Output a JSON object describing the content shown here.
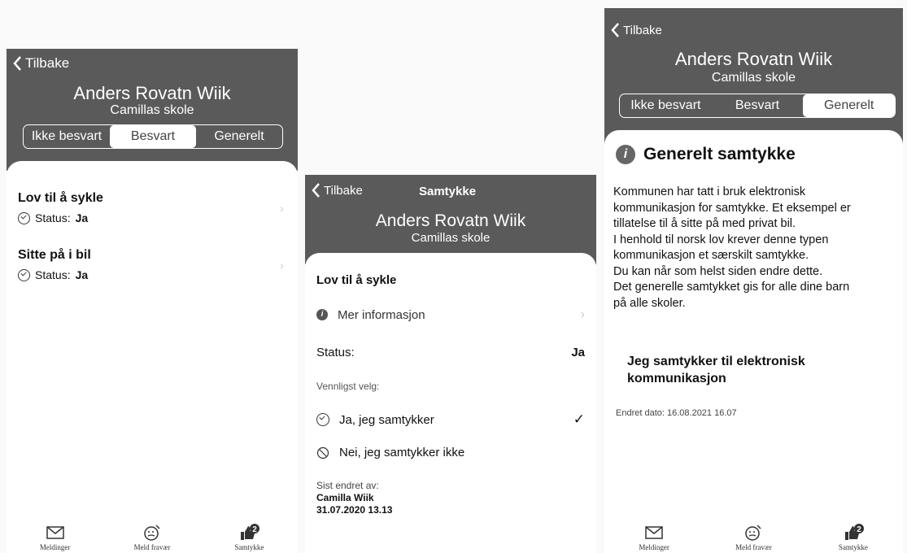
{
  "colors": {
    "header": "#5a5a5a",
    "sheet": "#ffffff",
    "text": "#111111"
  },
  "screen1": {
    "back": "Tilbake",
    "name": "Anders Rovatn Wiik",
    "school": "Camillas skole",
    "tabs": [
      "Ikke besvart",
      "Besvart",
      "Generelt"
    ],
    "selected_tab": "Besvart",
    "items": [
      {
        "title": "Lov til å sykle",
        "status_label": "Status:",
        "status_value": "Ja"
      },
      {
        "title": "Sitte på i bil",
        "status_label": "Status:",
        "status_value": "Ja"
      }
    ],
    "tabbar": [
      {
        "label": "Meldinger",
        "icon": "mail-icon"
      },
      {
        "label": "Meld fravær",
        "icon": "edit-face-icon"
      },
      {
        "label": "Samtykke",
        "icon": "thumbs-up-icon",
        "badge": "2"
      }
    ]
  },
  "screen2": {
    "back": "Tilbake",
    "title": "Samtykke",
    "name": "Anders Rovatn Wiik",
    "school": "Camillas skole",
    "item_title": "Lov til å sykle",
    "more_info": "Mer informasjon",
    "status_label": "Status:",
    "status_value": "Ja",
    "choose_label": "Vennligst velg:",
    "option_yes": "Ja, jeg samtykker",
    "option_no": "Nei, jeg samtykker ikke",
    "changed_by_label": "Sist endret av:",
    "changed_by_name": "Camilla Wiik",
    "changed_date": "31.07.2020 13.13"
  },
  "screen3": {
    "back": "Tilbake",
    "name": "Anders Rovatn Wiik",
    "school": "Camillas skole",
    "tabs": [
      "Ikke besvart",
      "Besvart",
      "Generelt"
    ],
    "selected_tab": "Generelt",
    "heading": "Generelt samtykke",
    "body_lines": [
      "Kommunen har tatt i bruk elektronisk",
      "kommunikasjon for samtykke. Et eksempel er",
      "tillatelse til å sitte på med privat bil.",
      "I henhold til norsk lov krever denne typen",
      "kommunikasjon et særskilt samtykke.",
      "Du kan når som helst siden endre dette.",
      "Det generelle samtykket gis for alle dine barn",
      "på alle skoler."
    ],
    "consent_line1": "Jeg samtykker til elektronisk",
    "consent_line2": "kommunikasjon",
    "changed_date": "Endret dato: 16.08.2021 16.07",
    "tabbar": [
      {
        "label": "Meldinger",
        "icon": "mail-icon"
      },
      {
        "label": "Meld fravær",
        "icon": "edit-face-icon"
      },
      {
        "label": "Samtykke",
        "icon": "thumbs-up-icon",
        "badge": "2"
      }
    ]
  }
}
